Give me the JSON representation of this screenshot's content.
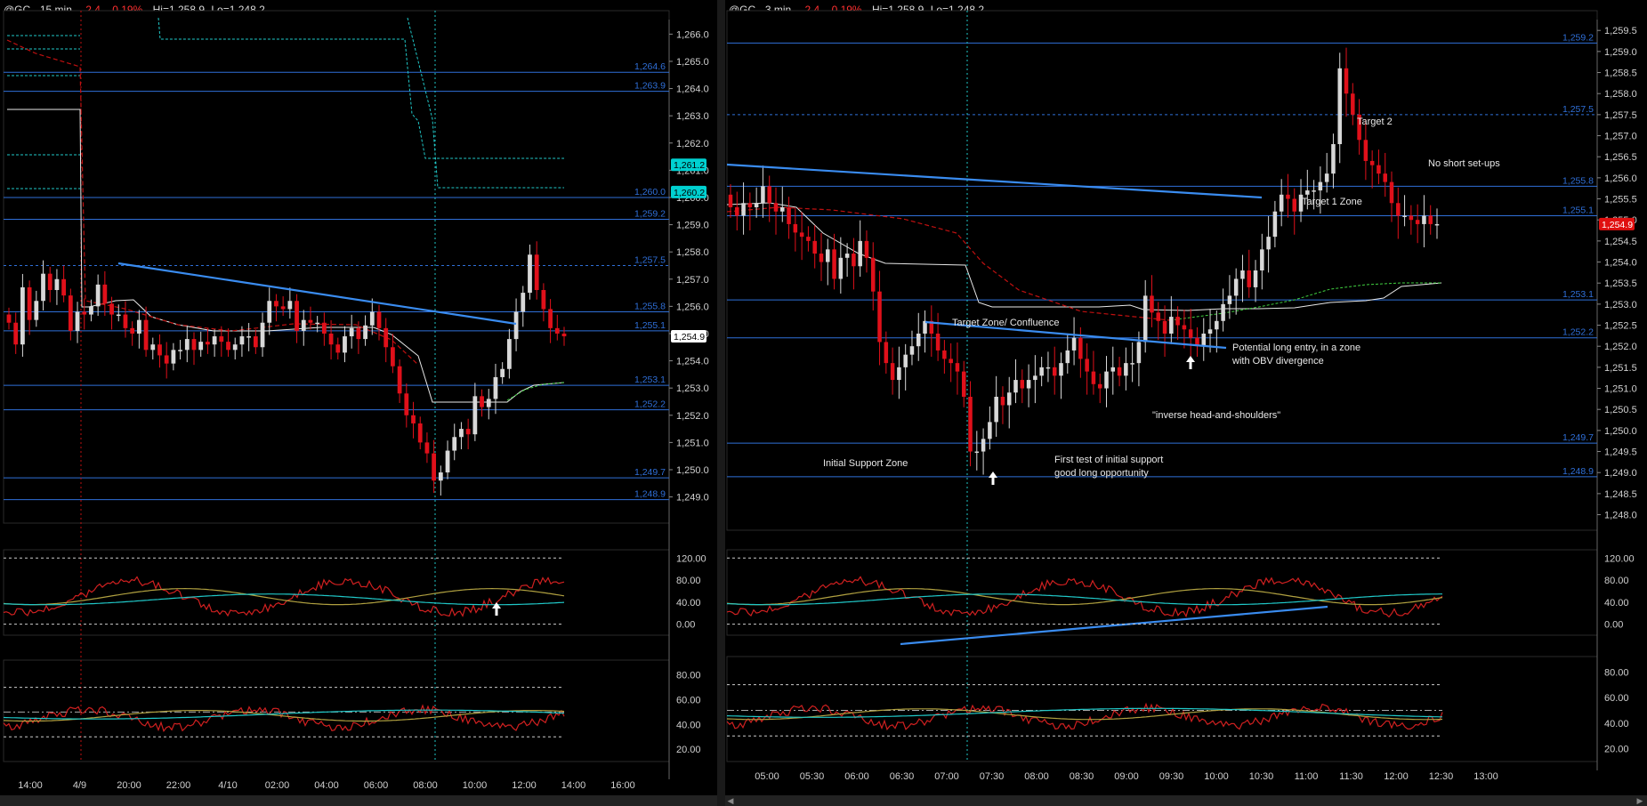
{
  "left": {
    "title": {
      "symbol": "@GC - 15 min",
      "change": "-2.4",
      "pct": "-0.19%",
      "hi": "Hi=1,258.9",
      "lo": "Lo=1,248.2"
    },
    "price_ticks": [
      "1,266.0",
      "1,265.0",
      "1,264.0",
      "1,263.0",
      "1,262.0",
      "1,261.0",
      "1,260.0",
      "1,259.0",
      "1,258.0",
      "1,257.0",
      "1,256.0",
      "1,255.0",
      "1,254.0",
      "1,253.0",
      "1,252.0",
      "1,251.0",
      "1,250.0",
      "1,249.0"
    ],
    "level_labels": [
      "1,264.6",
      "1,263.9",
      "1,260.0",
      "1,259.2",
      "1,257.5",
      "1,255.8",
      "1,255.1",
      "1,253.1",
      "1,252.2",
      "1,249.7",
      "1,248.9"
    ],
    "price_flags": [
      {
        "label": "1,261.2",
        "color": "#00d0d0"
      },
      {
        "label": "1,260.2",
        "color": "#00d0d0"
      },
      {
        "label": "1,254.9",
        "color": "#ffffff"
      }
    ],
    "ind1_ticks": [
      "120.00",
      "80.00",
      "40.00",
      "0.00"
    ],
    "ind2_ticks": [
      "80.00",
      "60.00",
      "40.00",
      "20.00"
    ],
    "time_ticks": [
      "14:00",
      "4/9",
      "20:00",
      "22:00",
      "4/10",
      "02:00",
      "04:00",
      "06:00",
      "08:00",
      "10:00",
      "12:00",
      "14:00",
      "16:00"
    ]
  },
  "right": {
    "title": {
      "symbol": "@GC - 3 min",
      "change": "-2.4",
      "pct": "-0.19%",
      "hi": "Hi=1,258.9",
      "lo": "Lo=1,248.2"
    },
    "price_ticks": [
      "1,259.5",
      "1,259.0",
      "1,258.5",
      "1,258.0",
      "1,257.5",
      "1,257.0",
      "1,256.5",
      "1,256.0",
      "1,255.5",
      "1,255.0",
      "1,254.5",
      "1,254.0",
      "1,253.5",
      "1,253.0",
      "1,252.5",
      "1,252.0",
      "1,251.5",
      "1,251.0",
      "1,250.5",
      "1,250.0",
      "1,249.5",
      "1,249.0",
      "1,248.5",
      "1,248.0"
    ],
    "level_labels": [
      "1,259.2",
      "1,257.5",
      "1,255.8",
      "1,255.1",
      "1,253.1",
      "1,252.2",
      "1,249.7",
      "1,248.9"
    ],
    "price_flags": [
      {
        "label": "1,254.9",
        "color": "#e01010"
      }
    ],
    "ind1_ticks": [
      "120.00",
      "80.00",
      "40.00",
      "0.00"
    ],
    "ind2_ticks": [
      "80.00",
      "60.00",
      "40.00",
      "20.00"
    ],
    "time_ticks": [
      "05:00",
      "05:30",
      "06:00",
      "06:30",
      "07:00",
      "07:30",
      "08:00",
      "08:30",
      "09:00",
      "09:30",
      "10:00",
      "10:30",
      "11:00",
      "11:30",
      "12:00",
      "12:30",
      "13:00"
    ],
    "annotations": [
      "Target 2",
      "No short set-ups",
      "Target 1 Zone",
      "Target Zone/ Confluence",
      "Potential long entry, in a zone",
      "with OBV divergence",
      "\"inverse head-and-shoulders\"",
      "Initial Support Zone",
      "First test of initial support",
      "good long opportunity"
    ]
  },
  "chart_data": [
    {
      "type": "candlestick",
      "title": "@GC - 15 min",
      "ylim": [
        1248.3,
        1266.6
      ],
      "levels": [
        1264.6,
        1263.9,
        1260.0,
        1259.2,
        1257.5,
        1255.8,
        1255.1,
        1253.1,
        1252.2,
        1249.7,
        1248.9
      ],
      "closes": [
        1255.4,
        1254.6,
        1256.7,
        1255.5,
        1256.2,
        1257.2,
        1256.6,
        1257.0,
        1256.4,
        1255.1,
        1255.8,
        1255.7,
        1256.0,
        1256.8,
        1256.1,
        1255.7,
        1255.7,
        1255.2,
        1255.0,
        1255.5,
        1254.4,
        1254.6,
        1254.2,
        1253.9,
        1254.4,
        1254.4,
        1254.8,
        1254.4,
        1254.7,
        1254.6,
        1254.9,
        1254.7,
        1254.4,
        1254.6,
        1254.9,
        1254.9,
        1254.5,
        1255.4,
        1256.2,
        1256.0,
        1255.9,
        1256.2,
        1255.1,
        1255.5,
        1255.4,
        1255.4,
        1255.0,
        1254.6,
        1254.3,
        1254.9,
        1255.2,
        1254.8,
        1255.3,
        1255.8,
        1255.2,
        1254.5,
        1253.8,
        1252.8,
        1252.0,
        1251.7,
        1251.0,
        1250.6,
        1249.6,
        1249.9,
        1250.7,
        1251.2,
        1251.5,
        1251.3,
        1252.7,
        1252.3,
        1252.6,
        1253.4,
        1253.7,
        1254.8,
        1255.8,
        1256.5,
        1257.9,
        1256.6,
        1255.9,
        1255.2,
        1255.0,
        1254.9
      ],
      "indicator_1": {
        "ticks": [
          120,
          80,
          40,
          0
        ]
      },
      "indicator_2": {
        "ticks": [
          80,
          60,
          40,
          20
        ]
      }
    },
    {
      "type": "candlestick",
      "title": "@GC - 3 min",
      "ylim": [
        1247.8,
        1259.8
      ],
      "levels": [
        1259.2,
        1257.5,
        1255.8,
        1255.1,
        1253.1,
        1252.2,
        1249.7,
        1248.9
      ],
      "closes": [
        1255.3,
        1255.1,
        1255.4,
        1255.3,
        1255.4,
        1255.8,
        1255.4,
        1255.2,
        1255.3,
        1254.9,
        1254.7,
        1254.6,
        1254.5,
        1254.2,
        1254.0,
        1254.3,
        1253.6,
        1254.1,
        1254.2,
        1253.9,
        1254.5,
        1254.1,
        1253.3,
        1252.1,
        1251.6,
        1251.2,
        1251.5,
        1251.8,
        1252.0,
        1252.3,
        1252.6,
        1252.3,
        1251.9,
        1251.7,
        1251.6,
        1251.4,
        1250.8,
        1249.5,
        1249.5,
        1249.8,
        1250.2,
        1250.8,
        1250.6,
        1250.9,
        1251.2,
        1251.0,
        1251.2,
        1251.3,
        1251.5,
        1251.5,
        1251.3,
        1251.6,
        1251.9,
        1252.2,
        1251.7,
        1251.4,
        1251.1,
        1251.0,
        1251.4,
        1251.5,
        1251.3,
        1251.6,
        1251.6,
        1252.1,
        1253.2,
        1252.8,
        1252.6,
        1252.3,
        1252.7,
        1252.5,
        1252.4,
        1252.2,
        1252.0,
        1252.3,
        1252.4,
        1252.6,
        1253.0,
        1253.2,
        1253.6,
        1253.8,
        1253.4,
        1253.8,
        1254.3,
        1254.6,
        1255.2,
        1255.6,
        1255.5,
        1255.2,
        1255.6,
        1255.7,
        1255.7,
        1255.9,
        1256.1,
        1256.8,
        1258.6,
        1258.0,
        1257.5,
        1256.9,
        1256.4,
        1256.3,
        1256.1,
        1255.9,
        1255.4,
        1255.1,
        1255.1,
        1255.0,
        1254.9,
        1255.1,
        1254.9,
        1254.9
      ]
    }
  ],
  "colors": {
    "up": "#d8d8d8",
    "down": "#e0101a",
    "level": "#2f6fd8",
    "zone": "#353535",
    "cyan": "#20c8c8",
    "grid": "#555555",
    "trend": "#3a8cf0",
    "axis": "#d0d0d0"
  }
}
